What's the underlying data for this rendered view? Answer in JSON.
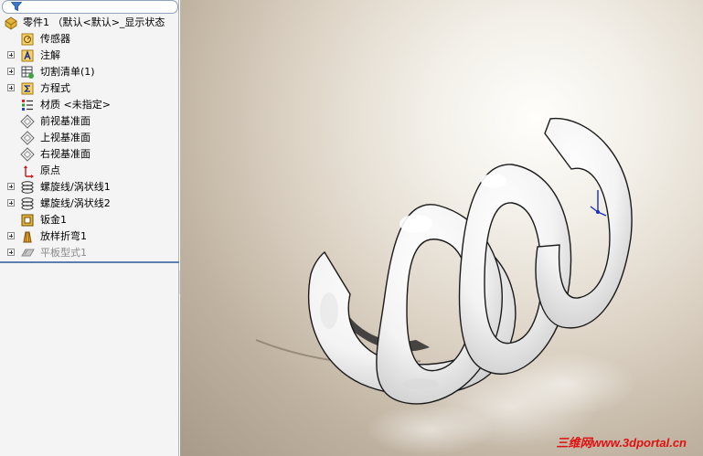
{
  "tree": {
    "root_label": "零件1 （默认<默认>_显示状态",
    "items": [
      {
        "label": "传感器",
        "icon": "sensor-icon",
        "expandable": false
      },
      {
        "label": "注解",
        "icon": "annotation-icon",
        "expandable": true
      },
      {
        "label": "切割清单(1)",
        "icon": "cut-list-icon",
        "expandable": true
      },
      {
        "label": "方程式",
        "icon": "equation-icon",
        "expandable": true
      },
      {
        "label": "材质 <未指定>",
        "icon": "material-icon",
        "expandable": false
      },
      {
        "label": "前视基准面",
        "icon": "plane-icon",
        "expandable": false
      },
      {
        "label": "上视基准面",
        "icon": "plane-icon",
        "expandable": false
      },
      {
        "label": "右视基准面",
        "icon": "plane-icon",
        "expandable": false
      },
      {
        "label": "原点",
        "icon": "origin-icon",
        "expandable": false
      },
      {
        "label": "螺旋线/涡状线1",
        "icon": "helix-icon",
        "expandable": true
      },
      {
        "label": "螺旋线/涡状线2",
        "icon": "helix-icon",
        "expandable": true
      },
      {
        "label": "钣金1",
        "icon": "sheet-metal-icon",
        "expandable": false
      },
      {
        "label": "放样折弯1",
        "icon": "lofted-bend-icon",
        "expandable": true
      },
      {
        "label": "平板型式1",
        "icon": "flat-pattern-icon",
        "expandable": true,
        "suppressed": true
      }
    ]
  },
  "watermark": "三维网www.3dportal.cn",
  "colors": {
    "selection_blue": "#5a7fb0",
    "watermark_red": "#e01010",
    "viewport_light": "#fffefb",
    "viewport_dark": "#a89a88"
  }
}
